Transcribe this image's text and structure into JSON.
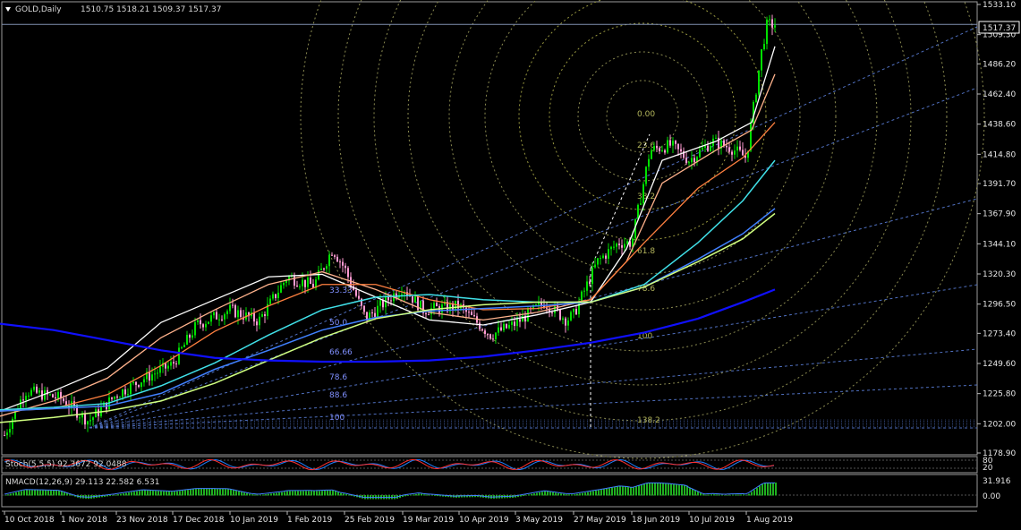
{
  "header": {
    "symbol": "GOLD,Daily",
    "ohlc": "1510.75 1518.21 1509.37 1517.37"
  },
  "current_price_label": "1517.37",
  "price_axis": {
    "ticks": [
      "1533.10",
      "1509.30",
      "1486.20",
      "1462.40",
      "1438.60",
      "1414.80",
      "1391.70",
      "1367.90",
      "1344.10",
      "1320.30",
      "1296.50",
      "1273.40",
      "1249.60",
      "1225.80",
      "1202.00",
      "1178.90"
    ]
  },
  "date_axis": {
    "ticks": [
      "10 Oct 2018",
      "1 Nov 2018",
      "23 Nov 2018",
      "17 Dec 2018",
      "10 Jan 2019",
      "1 Feb 2019",
      "25 Feb 2019",
      "19 Mar 2019",
      "10 Apr 2019",
      "3 May 2019",
      "27 May 2019",
      "18 Jun 2019",
      "10 Jul 2019",
      "1 Aug 2019"
    ]
  },
  "fib_fan_labels": [
    "33.33",
    "50.0",
    "66.66",
    "78.6",
    "88.6",
    "100"
  ],
  "fib_arc_labels": [
    "0.00",
    "23.6",
    "38.2",
    "61.8",
    "78.6",
    "100",
    "138.2"
  ],
  "stoch": {
    "label": "Stoch(5,5,5) 92.3672 92.0488",
    "axis": [
      "80",
      "20"
    ]
  },
  "macd": {
    "label": "NMACD(12,26,9) 29.113 22.582 6.531",
    "axis": [
      "31.916",
      "0.00"
    ]
  },
  "colors": {
    "background": "#000000",
    "up_candle": "#00e000",
    "down_candle": "#ff9bd2",
    "ma_fast": "#ffffff",
    "ma_2": "#ffb28c",
    "ma_3": "#ff8040",
    "ma_4": "#40e0e8",
    "ma_5": "#4080ff",
    "ma_6": "#d0ff80",
    "ma_200": "#1010ff",
    "fan": "#5070c0",
    "arc": "#8a8a50"
  },
  "chart_data": {
    "type": "candlestick",
    "symbol": "GOLD",
    "timeframe": "Daily",
    "last_ohlc": {
      "open": 1510.75,
      "high": 1518.21,
      "low": 1509.37,
      "close": 1517.37
    },
    "ylim": [
      1178.9,
      1533.1
    ],
    "close_path": [
      [
        "10 Oct 2018",
        1193
      ],
      [
        "18 Oct 2018",
        1228
      ],
      [
        "1 Nov 2018",
        1222
      ],
      [
        "12 Nov 2018",
        1204
      ],
      [
        "23 Nov 2018",
        1225
      ],
      [
        "5 Dec 2018",
        1238
      ],
      [
        "17 Dec 2018",
        1249
      ],
      [
        "27 Dec 2018",
        1280
      ],
      [
        "10 Jan 2019",
        1292
      ],
      [
        "21 Jan 2019",
        1283
      ],
      [
        "1 Feb 2019",
        1318
      ],
      [
        "12 Feb 2019",
        1311
      ],
      [
        "20 Feb 2019",
        1340
      ],
      [
        "25 Feb 2019",
        1325
      ],
      [
        "5 Mar 2019",
        1285
      ],
      [
        "19 Mar 2019",
        1310
      ],
      [
        "27 Mar 2019",
        1292
      ],
      [
        "10 Apr 2019",
        1295
      ],
      [
        "23 Apr 2019",
        1272
      ],
      [
        "3 May 2019",
        1281
      ],
      [
        "15 May 2019",
        1298
      ],
      [
        "24 May 2019",
        1284
      ],
      [
        "27 May 2019",
        1288
      ],
      [
        "5 Jun 2019",
        1330
      ],
      [
        "13 Jun 2019",
        1345
      ],
      [
        "18 Jun 2019",
        1345
      ],
      [
        "25 Jun 2019",
        1418
      ],
      [
        "3 Jul 2019",
        1422
      ],
      [
        "10 Jul 2019",
        1410
      ],
      [
        "19 Jul 2019",
        1425
      ],
      [
        "26 Jul 2019",
        1420
      ],
      [
        "1 Aug 2019",
        1412
      ],
      [
        "7 Aug 2019",
        1498
      ],
      [
        "9 Aug 2019",
        1517.37
      ]
    ],
    "moving_averages": [
      {
        "values": [
          [
            0,
            1212
          ],
          [
            60,
            1228
          ],
          [
            120,
            1246
          ],
          [
            180,
            1282
          ],
          [
            240,
            1300
          ],
          [
            300,
            1318
          ],
          [
            360,
            1320
          ],
          [
            420,
            1302
          ],
          [
            480,
            1284
          ],
          [
            540,
            1280
          ],
          [
            600,
            1288
          ],
          [
            660,
            1298
          ],
          [
            700,
            1340
          ],
          [
            740,
            1410
          ],
          [
            800,
            1425
          ],
          [
            840,
            1440
          ],
          [
            866,
            1500
          ]
        ]
      },
      {
        "values": [
          [
            0,
            1208
          ],
          [
            60,
            1220
          ],
          [
            120,
            1238
          ],
          [
            180,
            1270
          ],
          [
            240,
            1292
          ],
          [
            300,
            1312
          ],
          [
            360,
            1322
          ],
          [
            420,
            1308
          ],
          [
            480,
            1290
          ],
          [
            540,
            1284
          ],
          [
            600,
            1290
          ],
          [
            660,
            1300
          ],
          [
            700,
            1330
          ],
          [
            740,
            1392
          ],
          [
            800,
            1418
          ],
          [
            840,
            1434
          ],
          [
            866,
            1478
          ]
        ]
      },
      {
        "values": [
          [
            0,
            1212
          ],
          [
            60,
            1214
          ],
          [
            120,
            1225
          ],
          [
            180,
            1248
          ],
          [
            240,
            1275
          ],
          [
            300,
            1295
          ],
          [
            360,
            1312
          ],
          [
            420,
            1312
          ],
          [
            480,
            1300
          ],
          [
            540,
            1292
          ],
          [
            600,
            1293
          ],
          [
            660,
            1300
          ],
          [
            720,
            1345
          ],
          [
            780,
            1388
          ],
          [
            830,
            1412
          ],
          [
            866,
            1440
          ]
        ]
      },
      {
        "values": [
          [
            0,
            1213
          ],
          [
            60,
            1215
          ],
          [
            120,
            1218
          ],
          [
            180,
            1232
          ],
          [
            240,
            1250
          ],
          [
            300,
            1272
          ],
          [
            360,
            1292
          ],
          [
            420,
            1302
          ],
          [
            480,
            1304
          ],
          [
            540,
            1300
          ],
          [
            600,
            1298
          ],
          [
            660,
            1298
          ],
          [
            720,
            1312
          ],
          [
            780,
            1345
          ],
          [
            830,
            1378
          ],
          [
            866,
            1410
          ]
        ]
      },
      {
        "values": [
          [
            0,
            1212
          ],
          [
            60,
            1214
          ],
          [
            120,
            1216
          ],
          [
            180,
            1226
          ],
          [
            240,
            1245
          ],
          [
            300,
            1260
          ],
          [
            360,
            1276
          ],
          [
            420,
            1286
          ],
          [
            480,
            1291
          ],
          [
            540,
            1293
          ],
          [
            600,
            1295
          ],
          [
            660,
            1298
          ],
          [
            720,
            1310
          ],
          [
            780,
            1332
          ],
          [
            830,
            1352
          ],
          [
            866,
            1372
          ]
        ]
      },
      {
        "values": [
          [
            0,
            1203
          ],
          [
            60,
            1207
          ],
          [
            120,
            1212
          ],
          [
            180,
            1220
          ],
          [
            240,
            1234
          ],
          [
            300,
            1252
          ],
          [
            360,
            1270
          ],
          [
            420,
            1285
          ],
          [
            480,
            1292
          ],
          [
            540,
            1296
          ],
          [
            600,
            1298
          ],
          [
            660,
            1298
          ],
          [
            720,
            1310
          ],
          [
            780,
            1330
          ],
          [
            830,
            1348
          ],
          [
            866,
            1368
          ]
        ]
      },
      {
        "values": [
          [
            0,
            1281
          ],
          [
            60,
            1276
          ],
          [
            120,
            1268
          ],
          [
            180,
            1260
          ],
          [
            240,
            1254
          ],
          [
            300,
            1252
          ],
          [
            360,
            1251
          ],
          [
            420,
            1251
          ],
          [
            480,
            1252
          ],
          [
            540,
            1255
          ],
          [
            600,
            1260
          ],
          [
            660,
            1266
          ],
          [
            720,
            1274
          ],
          [
            780,
            1285
          ],
          [
            830,
            1298
          ],
          [
            866,
            1308
          ]
        ]
      }
    ],
    "stoch_value": [
      92.3672,
      92.0488
    ],
    "macd_value": [
      29.113,
      22.582,
      6.531
    ]
  }
}
